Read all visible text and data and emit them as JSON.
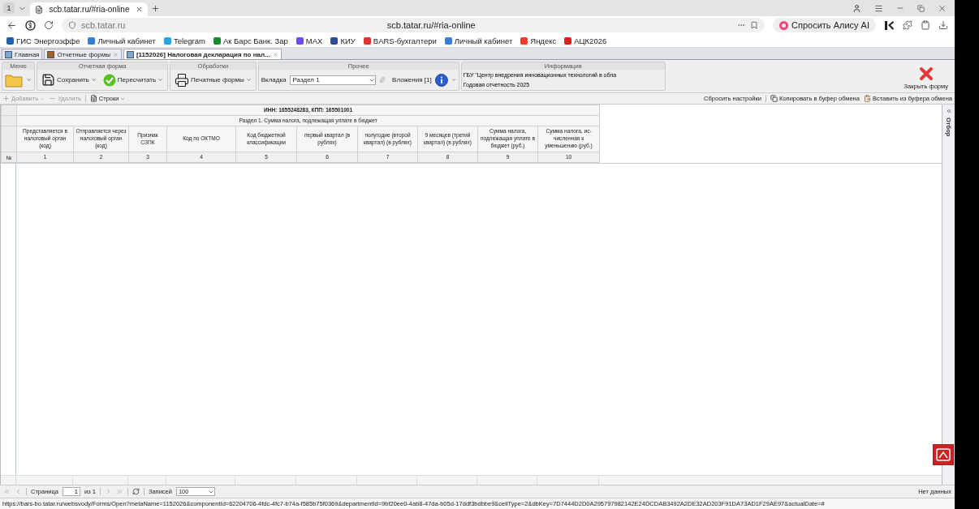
{
  "browser": {
    "tab_count": "1",
    "tab": {
      "title": "scb.tatar.ru/#ria-online"
    },
    "address": {
      "host": "scb.tatar.ru",
      "url": "scb.tatar.ru/#ria-online"
    },
    "alice_button": "Спросить Алису AI",
    "bookmarks": [
      {
        "label": "ГИС Энергоэффе",
        "color": "#1e5fb4"
      },
      {
        "label": "Личный кабинет",
        "color": "#3a7bd5"
      },
      {
        "label": "Telegram",
        "color": "#2aa3df"
      },
      {
        "label": "Ак Барс Банк. Зар",
        "color": "#1a8c2e"
      },
      {
        "label": "MAX",
        "color": "#6a4cf0"
      },
      {
        "label": "КИУ",
        "color": "#2a4c9a"
      },
      {
        "label": "BARS-бухгалтери",
        "color": "#e0332f"
      },
      {
        "label": "Личный кабинет",
        "color": "#3a7bd5"
      },
      {
        "label": "Яндекс",
        "color": "#f03c2e"
      },
      {
        "label": "АЦК2026",
        "color": "#d8231f"
      }
    ]
  },
  "app_tabs": [
    {
      "label": "Главная",
      "closable": false,
      "selected": false
    },
    {
      "label": "Отчетные формы",
      "closable": true,
      "selected": false
    },
    {
      "label": "[1152026] Налоговая декларация по нал...",
      "closable": true,
      "selected": true
    }
  ],
  "ribbon": {
    "groups": [
      {
        "kind": "menu",
        "title": "Меню"
      },
      {
        "kind": "form",
        "title": "Отчетная форма",
        "buttons": [
          "Сохранить",
          "Пересчитать"
        ]
      },
      {
        "kind": "processing",
        "title": "Обработки",
        "buttons": [
          "Печатные формы"
        ]
      },
      {
        "kind": "other",
        "title": "Прочее",
        "tab_label": "Вкладка",
        "tab_value": "Раздел 1",
        "attachments": "Вложения [1]"
      },
      {
        "kind": "info",
        "title": "Информация",
        "lines": [
          "ГБУ \"Центр внедрения инновационных технологий в обла",
          "Годовая отчетность 2025"
        ]
      }
    ],
    "close_button": "Закрыть форму"
  },
  "toolbar": {
    "left": [
      {
        "kind": "add",
        "label": "Добавить",
        "disabled": true
      },
      {
        "kind": "remove",
        "label": "Удалить",
        "disabled": true
      },
      {
        "kind": "rows",
        "label": "Строки",
        "disabled": false
      }
    ],
    "right": [
      {
        "kind": "reset",
        "label": "Сбросить настройки"
      },
      {
        "kind": "copy",
        "label": "Копировать в буфер обмена"
      },
      {
        "kind": "paste",
        "label": "Вставить из буфера обмена"
      }
    ]
  },
  "grid": {
    "captions": [
      "ИНН: 1655248283, КПП: 165501001",
      "Раздел 1. Сумма налога, подлежащая уплате в бюджет"
    ],
    "rownum_header": "№",
    "columns": [
      {
        "header": "Представляется в налоговый орган (код)",
        "number": "1"
      },
      {
        "header": "Отправляется через налоговый орган (код)",
        "number": "2"
      },
      {
        "header": "Признак СЗПК",
        "number": "3"
      },
      {
        "header": "Код по ОКТМО",
        "number": "4"
      },
      {
        "header": "Код бюджетной классификации",
        "number": "5"
      },
      {
        "header": "первый квартал (в рублях)",
        "number": "6"
      },
      {
        "header": "полугодие (второй квартал) (в рублях)",
        "number": "7"
      },
      {
        "header": "9 месяцев (третий квартал) (в рублях)",
        "number": "8"
      },
      {
        "header": "Сумма налога, подлежащая уплате в бюджет (руб.)",
        "number": "9"
      },
      {
        "header": "Сумма налога, ис-численная к уменьшению (руб.)",
        "number": "10"
      }
    ]
  },
  "side_panel": {
    "title": "Отбор"
  },
  "pager": {
    "page_label": "Страница",
    "page": "1",
    "of_label": "из 1",
    "records_label": "Записей",
    "page_size": "100",
    "status": "Нет данных"
  },
  "status_url": "https://bars-bo.tatar.ru/websvody/Forms/Open?metaName=1152026&componentId=62204706-4fdc-4fc7-b74a-f585b75f0369&departmentId=9bf20ee0-4ab8-47da-b05d-17ddf3bdbbe9&cellType=2&dbKey=7D7444D2D0A295797982142E24DCDAB3492A2DE32AD203F91DA73AD1F29AE97&actualDate=#"
}
